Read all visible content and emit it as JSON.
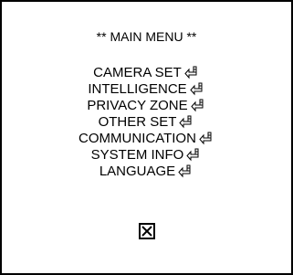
{
  "menu": {
    "title": "** MAIN MENU **",
    "items": [
      {
        "label": "CAMERA SET",
        "icon": "enter-key-icon"
      },
      {
        "label": "INTELLIGENCE",
        "icon": "enter-key-icon"
      },
      {
        "label": "PRIVACY ZONE",
        "icon": "enter-key-icon"
      },
      {
        "label": "OTHER SET",
        "icon": "enter-key-icon"
      },
      {
        "label": "COMMUNICATION",
        "icon": "enter-key-icon"
      },
      {
        "label": "SYSTEM INFO",
        "icon": "enter-key-icon"
      },
      {
        "label": "LANGUAGE",
        "icon": "enter-key-icon"
      }
    ],
    "exit_icon": "boxed-x-icon"
  },
  "colors": {
    "background": "#ffffff",
    "foreground": "#000000"
  }
}
